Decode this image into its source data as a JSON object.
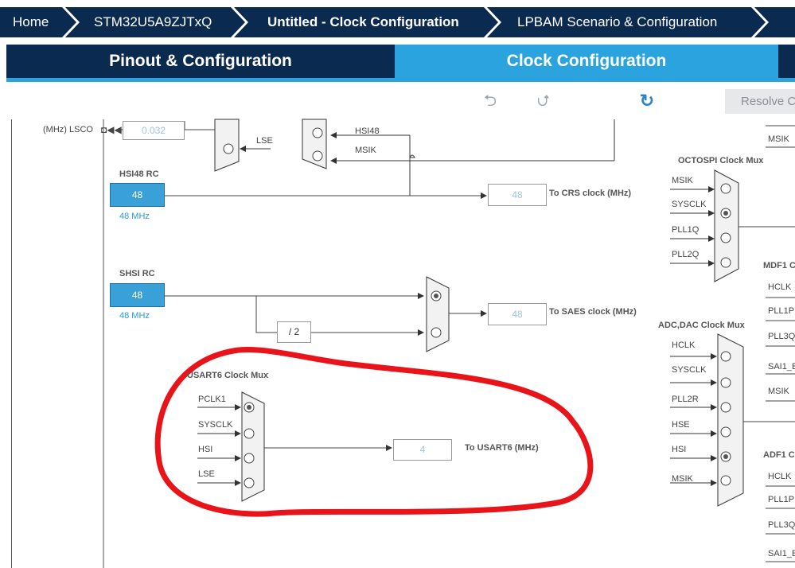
{
  "breadcrumbs": [
    "Home",
    "STM32U5A9ZJTxQ",
    "Untitled - Clock Configuration",
    "LPBAM Scenario & Configuration"
  ],
  "tabs": {
    "pinout": "Pinout & Configuration",
    "clock": "Clock Configuration"
  },
  "toolbar": {
    "undo_icon": "undo-icon",
    "redo_icon": "redo-icon",
    "refresh_icon": "refresh-icon",
    "resolve_label": "Resolve C"
  },
  "lsco": {
    "label": "(MHz) LSCO",
    "value": "0.032"
  },
  "inputs_top": {
    "lse": "LSE",
    "hsi48": "HSI48",
    "msik": "MSIK"
  },
  "hsi48rc": {
    "title": "HSI48 RC",
    "value": "48",
    "freq": "48 MHz",
    "crs_value": "48",
    "crs_label": "To CRS clock (MHz)"
  },
  "shsirc": {
    "title": "SHSI RC",
    "value": "48",
    "freq": "48 MHz",
    "divider": "/ 2",
    "saes_value": "48",
    "saes_label": "To SAES clock (MHz)"
  },
  "usart6": {
    "title": "USART6 Clock Mux",
    "inputs": [
      "PCLK1",
      "SYSCLK",
      "HSI",
      "LSE"
    ],
    "value": "4",
    "label": "To USART6 (MHz)"
  },
  "octospi": {
    "title": "OCTOSPI Clock Mux",
    "inputs": [
      "MSIK",
      "SYSCLK",
      "PLL1Q",
      "PLL2Q"
    ],
    "top_right_label": "MSIK"
  },
  "mdf1": {
    "title": "MDF1 C",
    "inputs": [
      "HCLK",
      "PLL1P",
      "PLL3Q",
      "SAI1_E",
      "MSIK"
    ]
  },
  "adcdac": {
    "title": "ADC,DAC Clock Mux",
    "inputs": [
      "HCLK",
      "SYSCLK",
      "PLL2R",
      "HSE",
      "HSI",
      "MSIK"
    ]
  },
  "adf1": {
    "title": "ADF1 C",
    "inputs": [
      "HCLK",
      "PLL1P",
      "PLL3Q",
      "SAI1_E"
    ]
  },
  "colors": {
    "navy": "#0b2a4f",
    "accent": "#2aa3de",
    "annotation": "#e8141a"
  }
}
